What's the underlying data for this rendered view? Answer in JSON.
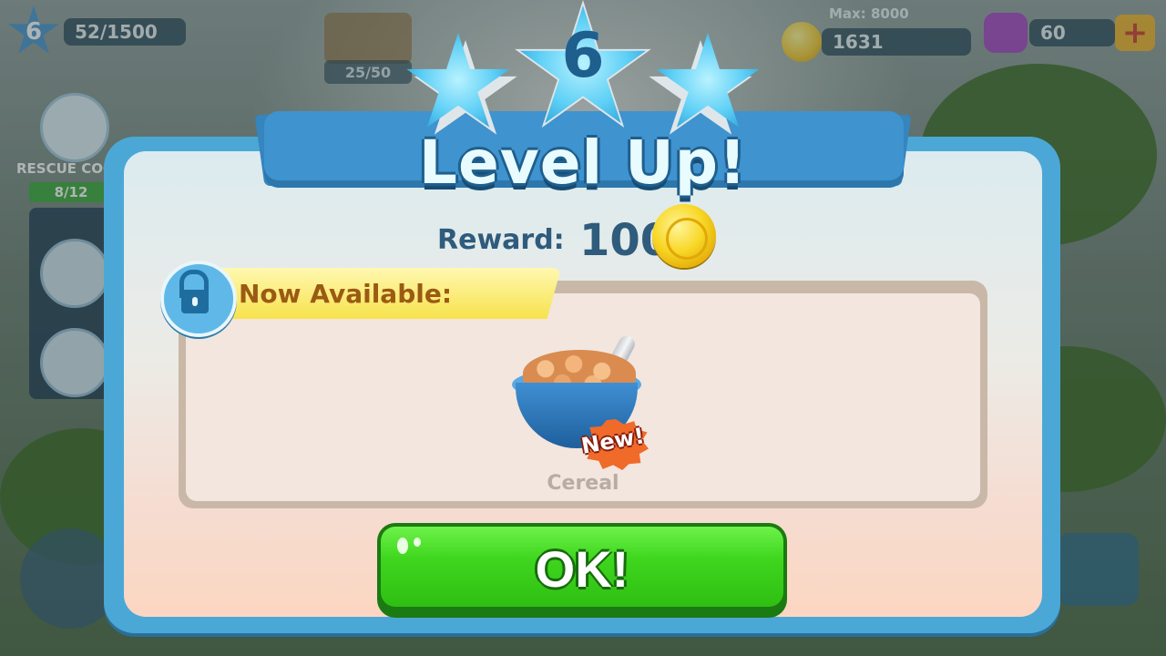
{
  "hud": {
    "player_level": "6",
    "xp": "52/1500",
    "building_progress": "25/50",
    "coins_max": "Max: 8000",
    "coins": "1631",
    "gems": "60"
  },
  "sidebar": {
    "rescue_label": "RESCUE COON",
    "rescue_progress": "8/12"
  },
  "dialog": {
    "level": "6",
    "title": "Level Up!",
    "reward_label": "Reward:",
    "reward_value": "100",
    "available_label": "Now Available:",
    "item": {
      "name": "Cereal",
      "badge": "New!"
    },
    "ok_label": "OK!"
  },
  "colors": {
    "dialog_border": "#4ba8d6",
    "ok_button": "#3fd61e",
    "title_text": "#e8fbff",
    "coin": "#f8d726"
  },
  "icons": {
    "hud_level": "star-icon",
    "coins": "coin-icon",
    "gems": "gem-icon",
    "add": "plus-icon",
    "unlock": "unlock-icon",
    "reward": "coin-icon"
  }
}
